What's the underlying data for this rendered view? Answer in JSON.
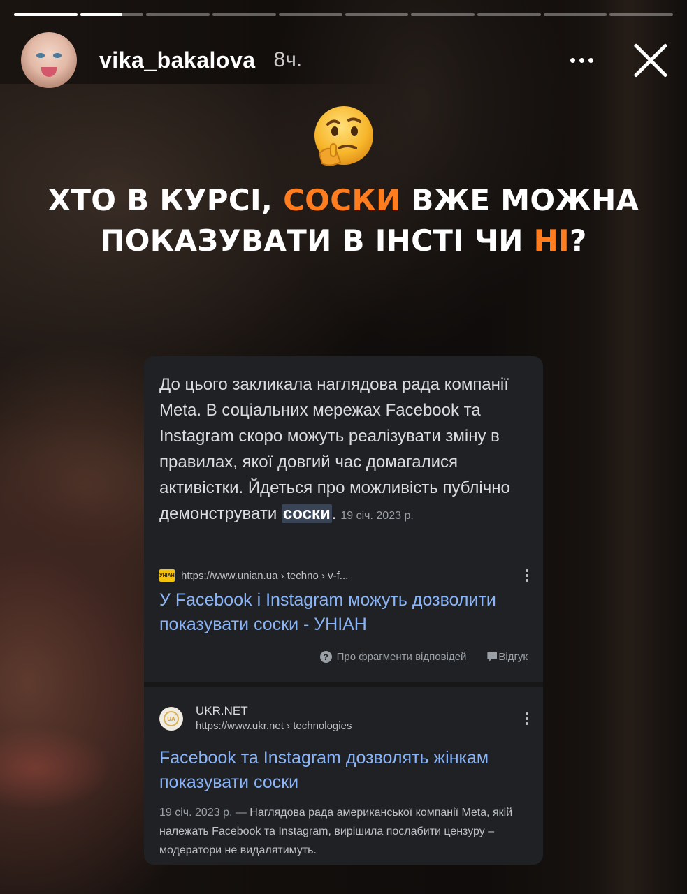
{
  "story": {
    "progress": {
      "segments": 10,
      "completed": 1,
      "current_fraction": 0.65
    },
    "user": {
      "username": "vika_bakalova",
      "time": "8ч."
    },
    "icons": {
      "more": "more-horizontal-icon",
      "close": "close-icon",
      "emoji": "thinking-face-emoji"
    }
  },
  "headline": {
    "line1_before": "ХТО В КУРСІ, ",
    "line1_highlight": "СОСКИ",
    "line1_after": " ВЖЕ МОЖНА",
    "line2_before": "ПОКАЗУВАТИ В ІНСТІ ЧИ ",
    "line2_highlight": "НІ",
    "line2_after": "?",
    "highlight_color": "#ff7d1e"
  },
  "search_card": {
    "snippet": {
      "text": "До цього закликала наглядова рада компанії Meta. В соціальних мережах Facebook та Instagram скоро можуть реалізувати зміну в правилах, якої довгий час домагалися активістки. Йдеться про можливість публічно демонструвати ",
      "keyword": "соски",
      "end": ".",
      "date": "19 січ. 2023 р."
    },
    "result1": {
      "favicon_text": "УНІАН",
      "url": "https://www.unian.ua › techno › v-f...",
      "title": "У Facebook і Instagram можуть дозволити показувати соски - УНІАН"
    },
    "feedback": {
      "about": "Про фрагменти відповідей",
      "feedback": "Відгук"
    },
    "result2": {
      "favicon_text": "UA",
      "site": "UKR.NET",
      "url": "https://www.ukr.net › technologies",
      "title": "Facebook та Instagram дозволять жінкам показувати соски",
      "date": "19 січ. 2023 р.",
      "dash": " — ",
      "description": "Наглядова рада американської компанії Meta, якій належать Facebook та Instagram, вирішила послабити цензуру – модератори не видалятимуть."
    }
  }
}
